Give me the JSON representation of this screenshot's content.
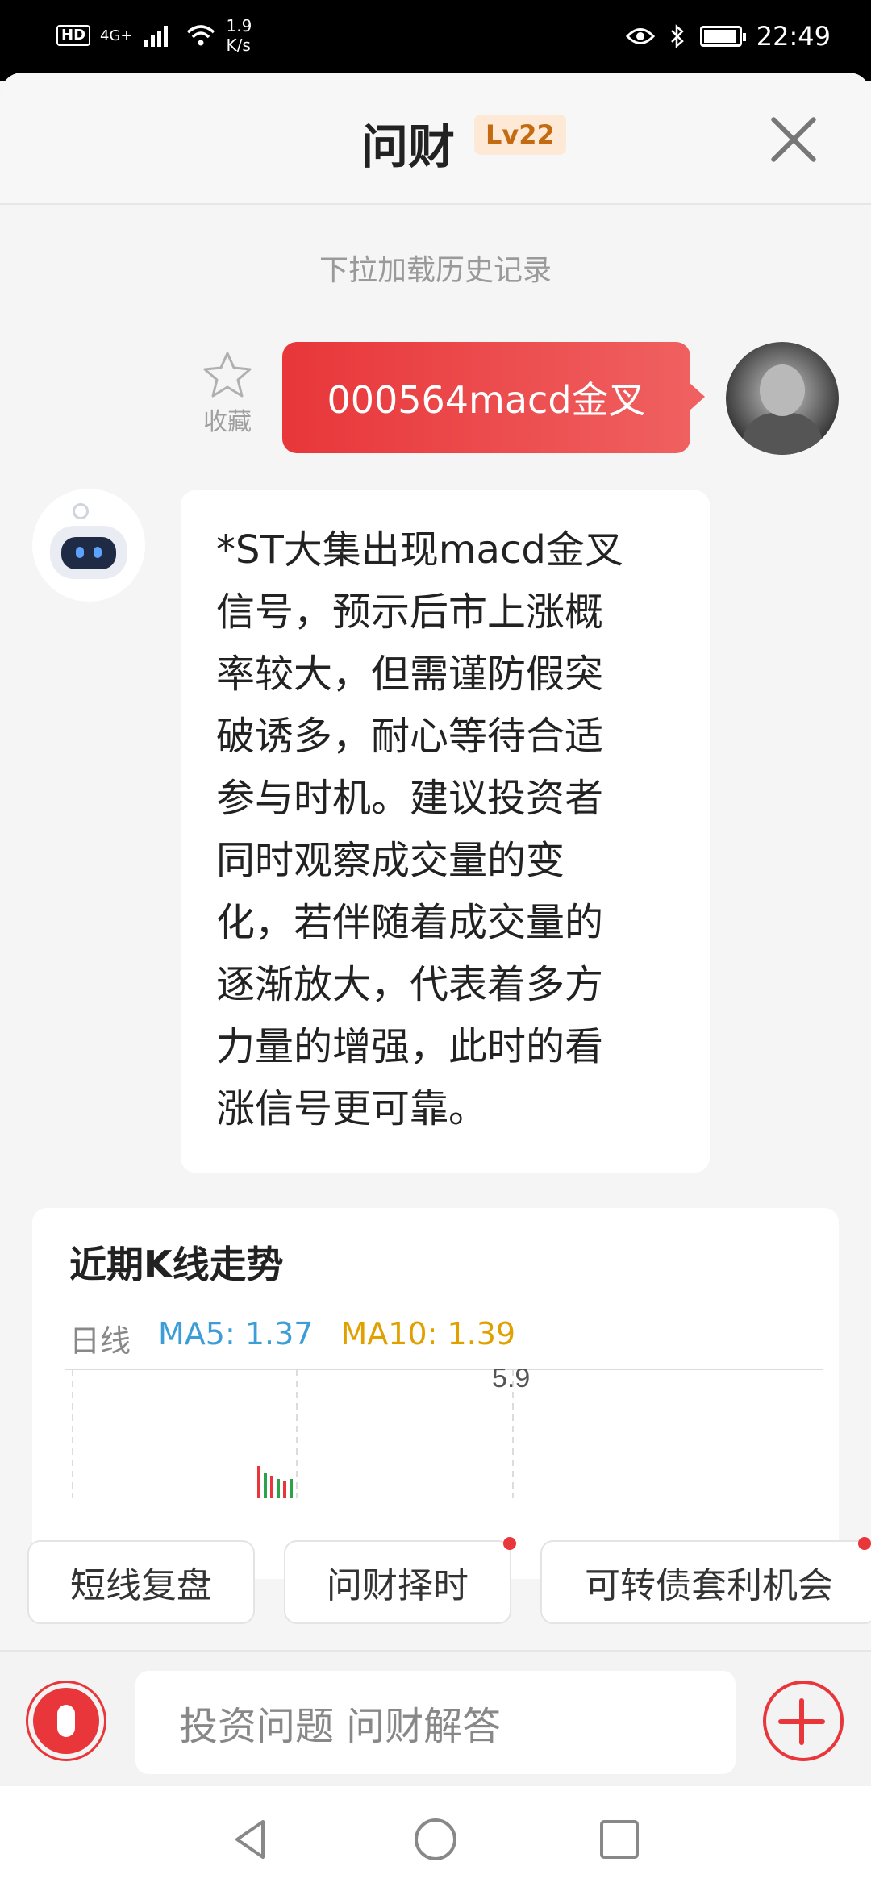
{
  "status_bar": {
    "hd": "HD",
    "network": "4G+",
    "speed_value": "1.9",
    "speed_unit": "K/s",
    "time": "22:49",
    "battery_level": 0.85
  },
  "header": {
    "title": "问财",
    "level": "Lv22"
  },
  "chat": {
    "history_hint": "下拉加载历史记录",
    "favorite_label": "收藏",
    "user_message": "000564macd金叉",
    "bot_message_lines": [
      "*ST大集出现macd金叉",
      "信号，预示后市上涨概",
      "率较大，但需谨防假突",
      "破诱多，耐心等待合适",
      "参与时机。建议投资者",
      "同时观察成交量的变",
      "化，若伴随着成交量的",
      "逐渐放大，代表着多方",
      "力量的增强，此时的看",
      "涨信号更可靠。"
    ]
  },
  "card": {
    "title": "近期K线走势",
    "period": "日线",
    "ma5": "MA5: 1.37",
    "ma10": "MA10: 1.39",
    "accent_up": "#e8363a",
    "accent_down": "#2aa34a"
  },
  "chart_data": {
    "type": "candlestick",
    "y_ticks": [
      "5.9"
    ],
    "ma5": 1.37,
    "ma10": 1.39
  },
  "quick_actions": [
    {
      "label": "短线复盘",
      "dot": false
    },
    {
      "label": "问财择时",
      "dot": true
    },
    {
      "label": "可转债套利机会",
      "dot": true
    }
  ],
  "input": {
    "placeholder": "投资问题 问财解答"
  },
  "colors": {
    "brand_red": "#e8363a",
    "level_badge_bg": "#fde9d6",
    "level_badge_text": "#c46b12"
  }
}
